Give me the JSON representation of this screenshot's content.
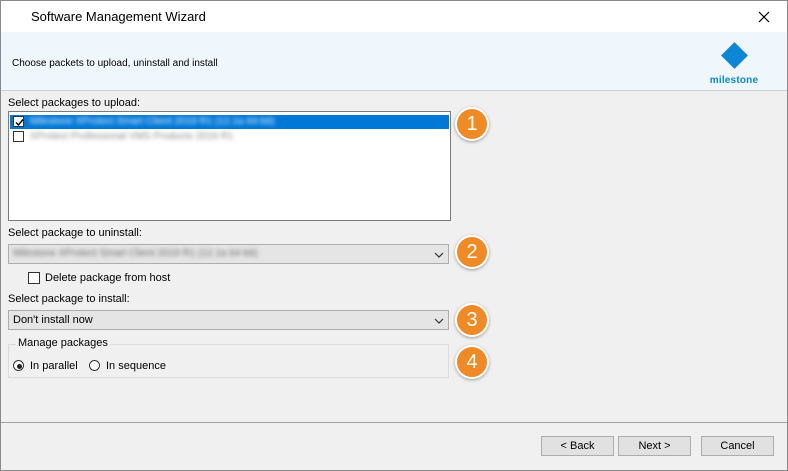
{
  "window": {
    "title": "Software Management Wizard"
  },
  "header": {
    "text": "Choose packets to upload, uninstall and install",
    "logo_text": "milestone",
    "logo_color": "#0c86d6"
  },
  "upload": {
    "label": "Select packages to upload:",
    "items": [
      {
        "text": "Milestone XProtect Smart Client 2019 R1 (12.1a 64-bit)",
        "checked": true,
        "selected": true
      },
      {
        "text": "XProtect Professional VMS Products 2019 R1",
        "checked": false,
        "selected": false
      }
    ]
  },
  "uninstall": {
    "label": "Select package to uninstall:",
    "selected": "Milestone XProtect Smart Client 2019 R1 (12.1a 64-bit)",
    "delete_label": "Delete package from host"
  },
  "install": {
    "label": "Select package to install:",
    "selected": "Don't install now"
  },
  "manage": {
    "title": "Manage packages",
    "options": [
      {
        "label": "In parallel",
        "checked": true
      },
      {
        "label": "In sequence",
        "checked": false
      }
    ]
  },
  "badges": [
    "1",
    "2",
    "3",
    "4"
  ],
  "badge_color": "#f08a24",
  "buttons": {
    "back": "< Back",
    "next": "Next >",
    "cancel": "Cancel"
  }
}
